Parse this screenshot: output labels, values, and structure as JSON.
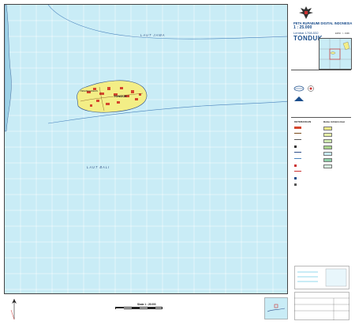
{
  "map": {
    "sea_north_label": "LAUT JAWA",
    "sea_south_label": "LAUT BALI",
    "island_label": "TONDUK",
    "island_sub_label": "PESANGGRAHAN",
    "colors": {
      "sea": "#c9ecf6",
      "land": "#f3ee86",
      "grid": "#ffffff",
      "coast": "#2e4f8a",
      "settlement": "#d4462d"
    }
  },
  "title_block": {
    "series": "PETA RUPABUMI DIGITAL INDONESIA",
    "scale": "1 : 25.000",
    "sheet_number": "Lembar 1708-532",
    "sheet_name": "TONDUK",
    "edition": "EDISI : I - 1999"
  },
  "legend": {
    "heading_left": "KETERANGAN",
    "heading_right": "Batas Administrasi"
  },
  "scale_bar": {
    "label": "Skala 1 : 25.000"
  }
}
